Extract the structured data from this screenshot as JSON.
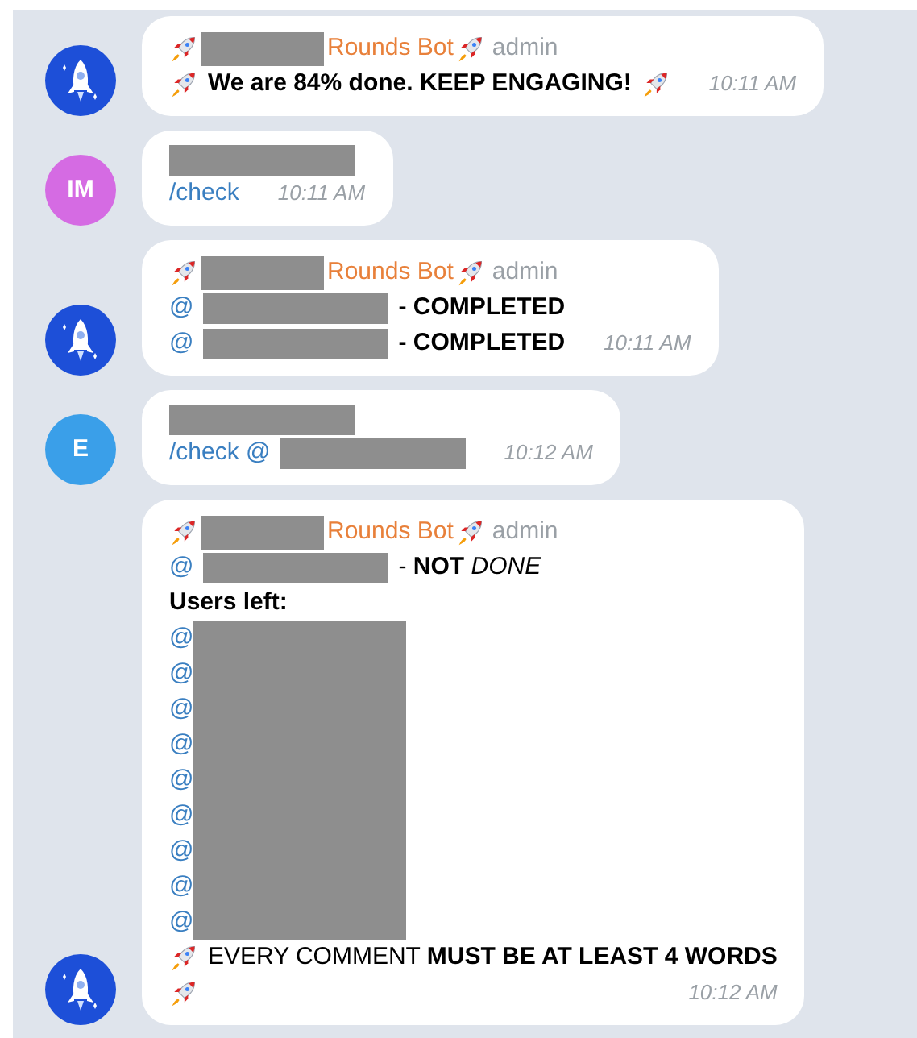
{
  "messages": [
    {
      "avatar": {
        "kind": "rocket",
        "color": "#1d4fd8"
      },
      "header": {
        "sender": "Rounds Bot",
        "role": "admin"
      },
      "time": "10:11 AM",
      "lines": [
        [
          {
            "kind": "rocket"
          },
          {
            "kind": "text",
            "text": "We are 84% done. KEEP ENGAGING!",
            "bold": true
          },
          {
            "kind": "rocket"
          }
        ]
      ]
    },
    {
      "avatar": {
        "kind": "initials",
        "text": "IM",
        "color": "#d56be3"
      },
      "time": "10:11 AM",
      "lines": [
        [
          {
            "kind": "redacted"
          }
        ],
        [
          {
            "kind": "link",
            "text": "/check"
          }
        ]
      ]
    },
    {
      "avatar": {
        "kind": "rocket",
        "color": "#1d4fd8"
      },
      "header": {
        "sender": "Rounds Bot",
        "role": "admin"
      },
      "time": "10:11 AM",
      "lines": [
        [
          {
            "kind": "link",
            "text": "@"
          },
          {
            "kind": "redacted"
          },
          {
            "kind": "text",
            "text": "- COMPLETED",
            "bold": true
          }
        ],
        [
          {
            "kind": "link",
            "text": "@"
          },
          {
            "kind": "redacted"
          },
          {
            "kind": "text",
            "text": "- COMPLETED",
            "bold": true
          }
        ]
      ]
    },
    {
      "avatar": {
        "kind": "initials",
        "text": "E",
        "color": "#3a9fe9"
      },
      "time": "10:12 AM",
      "lines": [
        [
          {
            "kind": "redacted"
          }
        ],
        [
          {
            "kind": "link",
            "text": "/check @"
          },
          {
            "kind": "redacted"
          }
        ]
      ]
    },
    {
      "avatar": {
        "kind": "rocket",
        "color": "#1d4fd8"
      },
      "header": {
        "sender": "Rounds Bot",
        "role": "admin"
      },
      "time": "10:12 AM",
      "lines": [
        [
          {
            "kind": "link",
            "text": "@"
          },
          {
            "kind": "redacted"
          },
          {
            "kind": "text",
            "text": "- **NOT** *DONE*"
          }
        ],
        [
          {
            "kind": "text",
            "text": "Users left:",
            "bold": true
          }
        ],
        [
          {
            "kind": "mention_list",
            "mentions": [
              "@",
              "@",
              "@",
              "@",
              "@",
              "@",
              "@",
              "@",
              "@"
            ]
          }
        ],
        [
          {
            "kind": "rocket"
          },
          {
            "kind": "text",
            "text": "EVERY COMMENT **MUST BE AT LEAST 4 WORDS**"
          }
        ],
        [
          {
            "kind": "rocket"
          }
        ]
      ]
    }
  ]
}
